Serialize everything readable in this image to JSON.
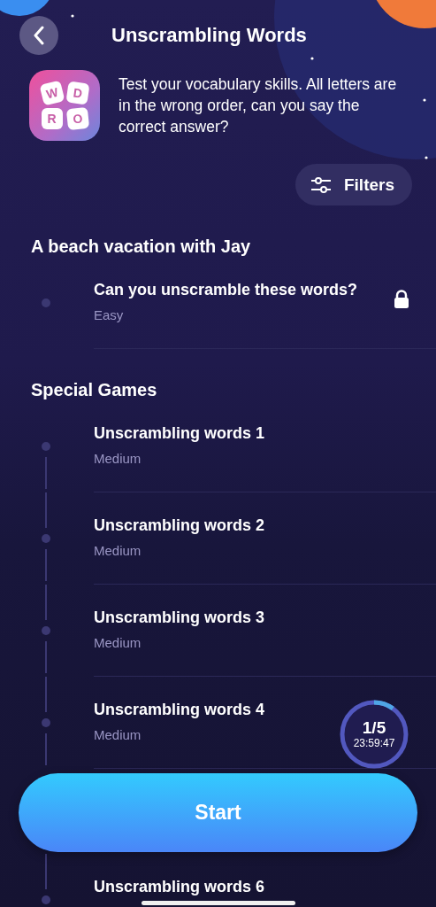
{
  "header": {
    "title": "Unscrambling Words"
  },
  "intro": {
    "icon_letters": [
      "W",
      "D",
      "R",
      "O"
    ],
    "description": "Test your vocabulary skills. All letters are in the wrong order, can you say the correct answer?"
  },
  "filters_button": {
    "label": "Filters"
  },
  "sections": [
    {
      "title": "A beach vacation with Jay",
      "games": [
        {
          "title": "Can you unscramble these words?",
          "difficulty": "Easy",
          "locked": true
        }
      ]
    },
    {
      "title": "Special Games",
      "games": [
        {
          "title": "Unscrambling words 1",
          "difficulty": "Medium",
          "locked": false
        },
        {
          "title": "Unscrambling words 2",
          "difficulty": "Medium",
          "locked": false
        },
        {
          "title": "Unscrambling words 3",
          "difficulty": "Medium",
          "locked": false
        },
        {
          "title": "Unscrambling words 4",
          "difficulty": "Medium",
          "locked": false,
          "timer": {
            "count": "1/5",
            "time": "23:59:47",
            "level": 0.1
          }
        },
        {
          "title": "Unscrambling words 6",
          "locked": false
        }
      ]
    }
  ],
  "start_button": {
    "label": "Start"
  }
}
